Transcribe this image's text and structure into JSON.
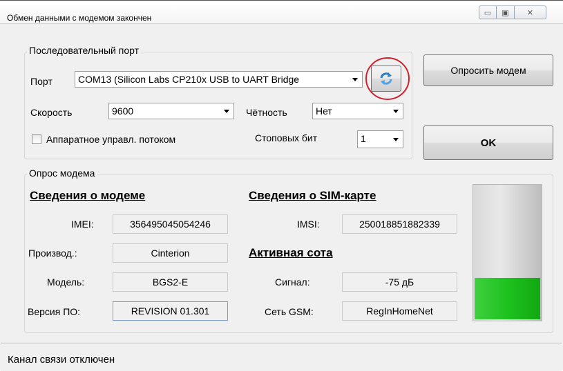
{
  "window": {
    "title": "Обмен данными с модемом закончен",
    "controls": {
      "minimize": "▭",
      "maximize": "▣",
      "close": "✕"
    }
  },
  "serial_port": {
    "group_title": "Последовательный порт",
    "port_label": "Порт",
    "port_value": "COM13 (Silicon Labs CP210x USB to UART Bridge",
    "refresh_icon": "refresh-icon",
    "speed_label": "Скорость",
    "speed_value": "9600",
    "parity_label": "Чётность",
    "parity_value": "Нет",
    "flow_control_label": "Аппаратное управл. потоком",
    "flow_control_checked": false,
    "stop_bits_label": "Стоповых бит",
    "stop_bits_value": "1"
  },
  "buttons": {
    "poll_modem": "Опросить модем",
    "ok": "OK"
  },
  "modem_poll": {
    "group_title": "Опрос модема",
    "modem_info_heading": "Сведения о модеме",
    "imei_label": "IMEI:",
    "imei_value": "356495045054246",
    "manufacturer_label": "Производ.:",
    "manufacturer_value": "Cinterion",
    "model_label": "Модель:",
    "model_value": "BGS2-E",
    "firmware_label": "Версия ПО:",
    "firmware_value": "REVISION 01.301",
    "sim_info_heading": "Сведения о SIM-карте",
    "imsi_label": "IMSI:",
    "imsi_value": "250018851882339",
    "active_cell_heading": "Активная сота",
    "signal_label": "Сигнал:",
    "signal_value": "-75 дБ",
    "gsm_network_label": "Сеть GSM:",
    "gsm_network_value": "RegInHomeNet",
    "signal_level_fraction": 0.31,
    "signal_bar_color": "#1ec21e"
  },
  "status_bar": {
    "text": "Канал связи отключен"
  },
  "accents": {
    "highlight_circle_color": "#d0202a"
  }
}
